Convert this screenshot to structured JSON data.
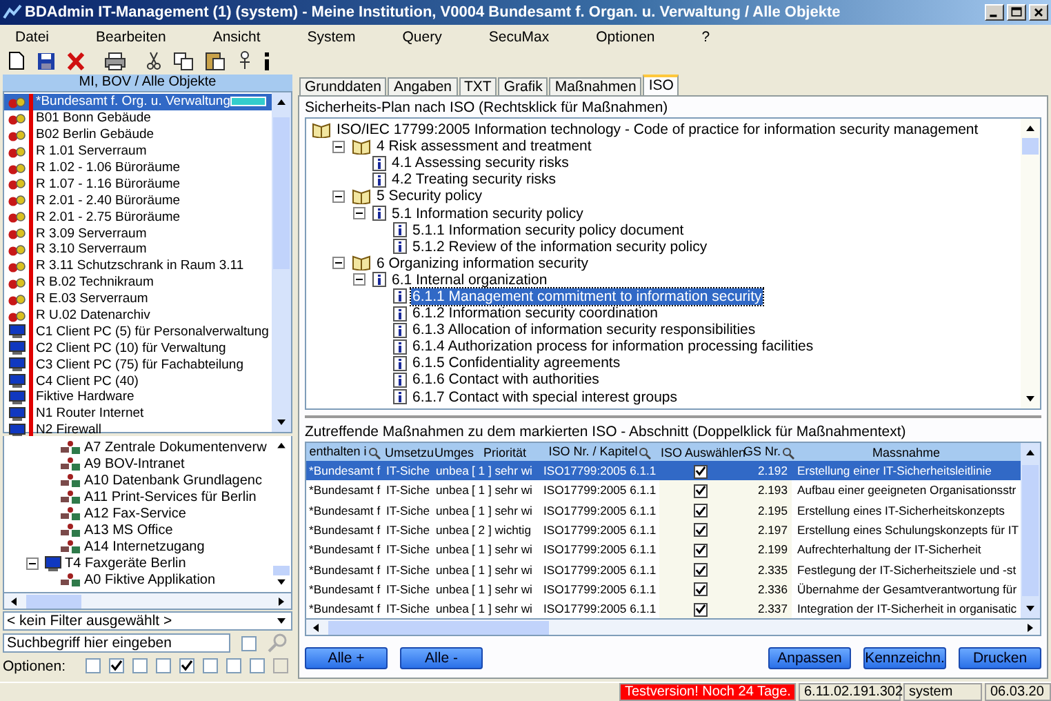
{
  "window": {
    "title": "BDAdmin IT-Management (1) (system) - Meine Institution, V0004 Bundesamt f. Organ. u. Verwaltung / Alle Objekte"
  },
  "menu": [
    "Datei",
    "Bearbeiten",
    "Ansicht",
    "System",
    "Query",
    "SecuMax",
    "Optionen",
    "?"
  ],
  "object_list": {
    "title": "MI, BOV / Alle Objekte",
    "items": [
      {
        "label": "*Bundesamt f. Org. u. Verwaltung",
        "kind": "room",
        "selected": true,
        "tagged": true
      },
      {
        "label": "B01 Bonn Gebäude",
        "kind": "room",
        "selected": false,
        "tagged": false
      },
      {
        "label": "B02 Berlin Gebäude",
        "kind": "room",
        "selected": false,
        "tagged": false
      },
      {
        "label": "R 1.01 Serverraum",
        "kind": "room",
        "selected": false,
        "tagged": false
      },
      {
        "label": "R 1.02 - 1.06 Büroräume",
        "kind": "room",
        "selected": false,
        "tagged": false
      },
      {
        "label": "R 1.07 - 1.16 Büroräume",
        "kind": "room",
        "selected": false,
        "tagged": false
      },
      {
        "label": "R 2.01 - 2.40 Büroräume",
        "kind": "room",
        "selected": false,
        "tagged": false
      },
      {
        "label": "R 2.01 - 2.75 Büroräume",
        "kind": "room",
        "selected": false,
        "tagged": false
      },
      {
        "label": "R 3.09 Serverraum",
        "kind": "room",
        "selected": false,
        "tagged": false
      },
      {
        "label": "R 3.10 Serverraum",
        "kind": "room",
        "selected": false,
        "tagged": false
      },
      {
        "label": "R 3.11 Schutzschrank in Raum 3.11",
        "kind": "room",
        "selected": false,
        "tagged": false
      },
      {
        "label": "R B.02 Technikraum",
        "kind": "room",
        "selected": false,
        "tagged": false
      },
      {
        "label": "R E.03 Serverraum",
        "kind": "room",
        "selected": false,
        "tagged": false
      },
      {
        "label": "R U.02 Datenarchiv",
        "kind": "room",
        "selected": false,
        "tagged": false
      },
      {
        "label": "C1 Client PC (5) für Personalverwaltung",
        "kind": "pc",
        "selected": false,
        "tagged": false
      },
      {
        "label": "C2 Client PC (10) für Verwaltung",
        "kind": "pc",
        "selected": false,
        "tagged": false
      },
      {
        "label": "C3 Client PC (75) für Fachabteilung",
        "kind": "pc",
        "selected": false,
        "tagged": false
      },
      {
        "label": "C4 Client PC (40)",
        "kind": "pc",
        "selected": false,
        "tagged": false
      },
      {
        "label": "Fiktive Hardware",
        "kind": "pc",
        "selected": false,
        "tagged": false
      },
      {
        "label": "N1 Router Internet",
        "kind": "pc",
        "selected": false,
        "tagged": false
      },
      {
        "label": "N2 Firewall",
        "kind": "pc",
        "selected": false,
        "tagged": false
      }
    ]
  },
  "object_tree": {
    "items": [
      {
        "label": "A7 Zentrale Dokumentenverw",
        "kind": "app"
      },
      {
        "label": "A9 BOV-Intranet",
        "kind": "app"
      },
      {
        "label": "A10 Datenbank Grundlagenc",
        "kind": "app"
      },
      {
        "label": "A11 Print-Services für Berlin",
        "kind": "app"
      },
      {
        "label": "A12 Fax-Service",
        "kind": "app"
      },
      {
        "label": "A13 MS Office",
        "kind": "app"
      },
      {
        "label": "A14 Internetzugang",
        "kind": "app"
      },
      {
        "label": "T4 Faxgeräte Berlin",
        "kind": "pc",
        "expanded": true,
        "children": [
          {
            "label": "A0 Fiktive Applikation",
            "kind": "app"
          }
        ]
      }
    ]
  },
  "filter": {
    "value": "< kein Filter ausgewählt >"
  },
  "search": {
    "placeholder": "Suchbegriff hier eingeben",
    "checked": false
  },
  "options": {
    "label": "Optionen:",
    "boxes": [
      {
        "checked": false,
        "disabled": false
      },
      {
        "checked": true,
        "disabled": false
      },
      {
        "checked": false,
        "disabled": false
      },
      {
        "checked": false,
        "disabled": false
      },
      {
        "checked": true,
        "disabled": false
      },
      {
        "checked": false,
        "disabled": false
      },
      {
        "checked": false,
        "disabled": false
      },
      {
        "checked": false,
        "disabled": false
      },
      {
        "checked": false,
        "disabled": true
      }
    ]
  },
  "tabs": [
    {
      "label": "Grunddaten",
      "selected": false
    },
    {
      "label": "Angaben",
      "selected": false
    },
    {
      "label": "TXT",
      "selected": false
    },
    {
      "label": "Grafik",
      "selected": false
    },
    {
      "label": "Maßnahmen",
      "selected": false
    },
    {
      "label": "ISO",
      "selected": true
    }
  ],
  "iso_plan": {
    "title": "Sicherheits-Plan nach ISO (Rechtsklick für Maßnahmen)",
    "tree": [
      {
        "label": "ISO/IEC 17799:2005 Information technology - Code of practice for information security management",
        "kind": "book",
        "expanded": true,
        "selected": false,
        "children": [
          {
            "label": "4  Risk assessment and treatment",
            "kind": "book",
            "expanded": true,
            "selected": false,
            "children": [
              {
                "label": "4.1  Assessing security risks",
                "kind": "info",
                "selected": false
              },
              {
                "label": "4.2  Treating security risks",
                "kind": "info",
                "selected": false
              }
            ]
          },
          {
            "label": "5  Security policy",
            "kind": "book",
            "expanded": true,
            "selected": false,
            "children": [
              {
                "label": "5.1  Information security policy",
                "kind": "info",
                "expanded": true,
                "selected": false,
                "children": [
                  {
                    "label": "5.1.1  Information security policy document",
                    "kind": "info",
                    "selected": false
                  },
                  {
                    "label": "5.1.2  Review of the information security policy",
                    "kind": "info",
                    "selected": false
                  }
                ]
              }
            ]
          },
          {
            "label": "6  Organizing information security",
            "kind": "book",
            "expanded": true,
            "selected": false,
            "children": [
              {
                "label": "6.1  Internal organization",
                "kind": "info",
                "expanded": true,
                "selected": false,
                "children": [
                  {
                    "label": "6.1.1  Management commitment to information security",
                    "kind": "info",
                    "selected": true
                  },
                  {
                    "label": "6.1.2  Information security coordination",
                    "kind": "info",
                    "selected": false
                  },
                  {
                    "label": "6.1.3  Allocation of information security responsibilities",
                    "kind": "info",
                    "selected": false
                  },
                  {
                    "label": "6.1.4  Authorization process for information processing facilities",
                    "kind": "info",
                    "selected": false
                  },
                  {
                    "label": "6.1.5  Confidentiality agreements",
                    "kind": "info",
                    "selected": false
                  },
                  {
                    "label": "6.1.6  Contact with authorities",
                    "kind": "info",
                    "selected": false
                  },
                  {
                    "label": "6.1.7  Contact with special interest groups",
                    "kind": "info",
                    "selected": false
                  }
                ]
              }
            ]
          }
        ]
      }
    ]
  },
  "measures": {
    "title": "Zutreffende Maßnahmen zu dem markierten ISO - Abschnitt (Doppelklick für Maßnahmentext)",
    "columns": [
      {
        "label": "enthalten i",
        "filter": true
      },
      {
        "label": "Umsetzu",
        "filter": false
      },
      {
        "label": "Umges",
        "filter": false
      },
      {
        "label": "Priorität",
        "filter": false
      },
      {
        "label": "ISO Nr. / Kapitel",
        "filter": true
      },
      {
        "label": "ISO Auswählen",
        "filter": false
      },
      {
        "label": "GS Nr.",
        "filter": true
      },
      {
        "label": "Massnahme",
        "filter": false
      }
    ],
    "rows": [
      {
        "cells": [
          "*Bundesamt f",
          "IT-Siche",
          "unbea",
          "[ 1 ] sehr wi",
          "ISO17799:2005   6.1.1",
          "",
          "2.192",
          "Erstellung einer IT-Sicherheitsleitlinie"
        ],
        "checked": true,
        "selected": true
      },
      {
        "cells": [
          "*Bundesamt f",
          "IT-Siche",
          "unbea",
          "[ 1 ] sehr wi",
          "ISO17799:2005   6.1.1",
          "",
          "2.193",
          "Aufbau einer geeigneten Organisationsstr"
        ],
        "checked": true,
        "selected": false
      },
      {
        "cells": [
          "*Bundesamt f",
          "IT-Siche",
          "unbea",
          "[ 1 ] sehr wi",
          "ISO17799:2005   6.1.1",
          "",
          "2.195",
          "Erstellung eines IT-Sicherheitskonzepts"
        ],
        "checked": true,
        "selected": false
      },
      {
        "cells": [
          "*Bundesamt f",
          "IT-Siche",
          "unbea",
          "[ 2 ] wichtig",
          "ISO17799:2005   6.1.1",
          "",
          "2.197",
          "Erstellung eines Schulungskonzepts für IT"
        ],
        "checked": true,
        "selected": false
      },
      {
        "cells": [
          "*Bundesamt f",
          "IT-Siche",
          "unbea",
          "[ 1 ] sehr wi",
          "ISO17799:2005   6.1.1",
          "",
          "2.199",
          "Aufrechterhaltung der IT-Sicherheit"
        ],
        "checked": true,
        "selected": false
      },
      {
        "cells": [
          "*Bundesamt f",
          "IT-Siche",
          "unbea",
          "[ 1 ] sehr wi",
          "ISO17799:2005   6.1.1",
          "",
          "2.335",
          "Festlegung der IT-Sicherheitsziele und -st"
        ],
        "checked": true,
        "selected": false
      },
      {
        "cells": [
          "*Bundesamt f",
          "IT-Siche",
          "unbea",
          "[ 1 ] sehr wi",
          "ISO17799:2005   6.1.1",
          "",
          "2.336",
          "Übernahme der Gesamtverantwortung für"
        ],
        "checked": true,
        "selected": false
      },
      {
        "cells": [
          "*Bundesamt f",
          "IT-Siche",
          "unbea",
          "[ 1 ] sehr wi",
          "ISO17799:2005   6.1.1",
          "",
          "2.337",
          "Integration der IT-Sicherheit in organisatic"
        ],
        "checked": true,
        "selected": false
      }
    ]
  },
  "buttons_left": [
    "Alle +",
    "Alle -"
  ],
  "buttons_right": [
    "Anpassen",
    "Kennzeichn.",
    "Drucken"
  ],
  "status_bar": [
    {
      "text": "Testversion! Noch 24 Tage.",
      "kind": "alert"
    },
    {
      "text": "6.11.02.191.302",
      "kind": "plain"
    },
    {
      "text": "system",
      "kind": "plain"
    },
    {
      "text": "06.03.20",
      "kind": "plain"
    }
  ]
}
